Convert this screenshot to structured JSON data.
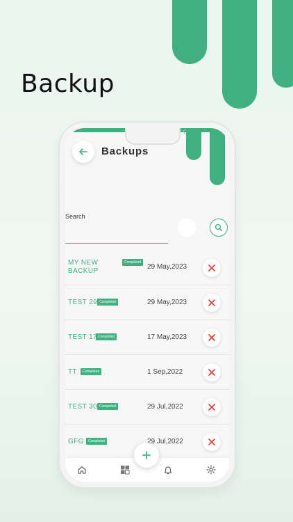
{
  "promo": {
    "title": "Backup"
  },
  "header": {
    "title": "Backups"
  },
  "search": {
    "label": "Search",
    "value": ""
  },
  "backups": [
    {
      "name": "MY NEW BACKUP",
      "status": "Completed",
      "date": "29 May,2023"
    },
    {
      "name": "TEST 29",
      "status": "Completed",
      "date": "29 May,2023"
    },
    {
      "name": "TEST 17",
      "status": "Completed",
      "date": "17 May,2023"
    },
    {
      "name": "TT",
      "status": "Completed",
      "date": "1 Sep,2022"
    },
    {
      "name": "TEST 30",
      "status": "Completed",
      "date": "29 Jul,2022"
    },
    {
      "name": "GFG",
      "status": "Completed",
      "date": "29 Jul,2022"
    }
  ],
  "nav": [
    "home-icon",
    "dashboard-icon",
    "bell-icon",
    "gear-icon"
  ],
  "colors": {
    "accent": "#3fb07f",
    "delete": "#e53935"
  }
}
